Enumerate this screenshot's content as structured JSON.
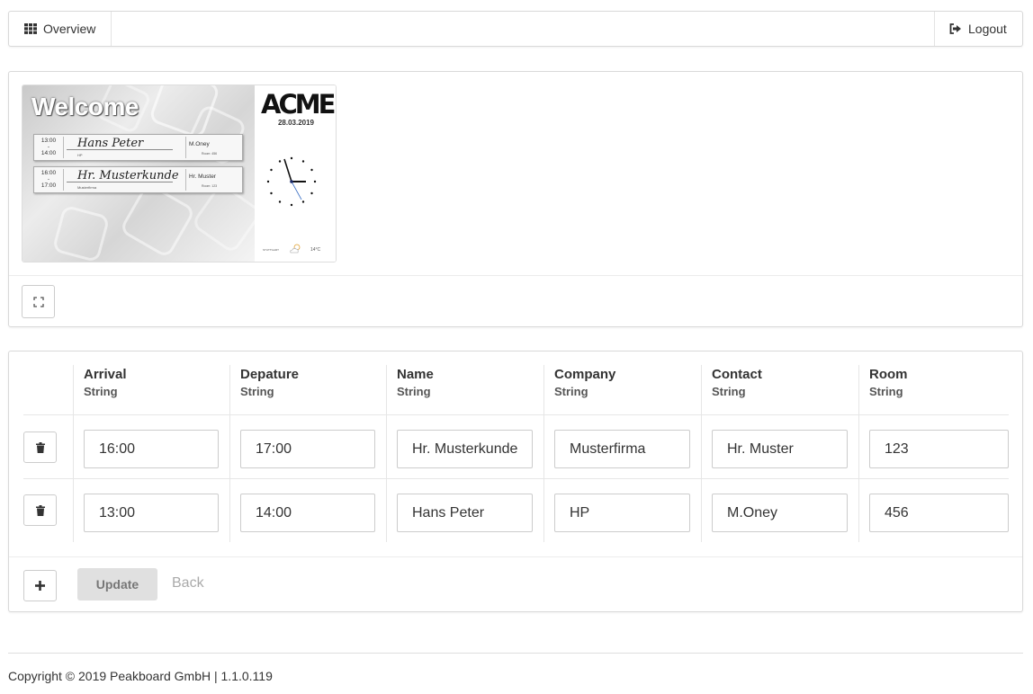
{
  "nav": {
    "overview_label": "Overview",
    "logout_label": "Logout"
  },
  "preview": {
    "welcome_text": "Welcome",
    "logo_text": "ACME",
    "date": "28.03.2019",
    "meetings": [
      {
        "start": "13:00",
        "end": "14:00",
        "name": "Hans Peter",
        "company": "HP",
        "contact": "M.Oney",
        "room": "Room: 456"
      },
      {
        "start": "16:00",
        "end": "17:00",
        "name": "Hr. Musterkunde",
        "company": "Musterfirma",
        "contact": "Hr. Muster",
        "room": "Room: 123"
      }
    ],
    "weather_city": "STUTTGART",
    "temperature": "14°C"
  },
  "table": {
    "columns": [
      {
        "title": "Arrival",
        "type": "String"
      },
      {
        "title": "Depature",
        "type": "String"
      },
      {
        "title": "Name",
        "type": "String"
      },
      {
        "title": "Company",
        "type": "String"
      },
      {
        "title": "Contact",
        "type": "String"
      },
      {
        "title": "Room",
        "type": "String"
      }
    ],
    "rows": [
      {
        "arrival": "16:00",
        "departure": "17:00",
        "name": "Hr. Musterkunde",
        "company": "Musterfirma",
        "contact": "Hr. Muster",
        "room": "123"
      },
      {
        "arrival": "13:00",
        "departure": "14:00",
        "name": "Hans Peter",
        "company": "HP",
        "contact": "M.Oney",
        "room": "456"
      }
    ],
    "update_label": "Update",
    "back_label": "Back"
  },
  "footer": {
    "copyright": "Copyright © 2019 Peakboard GmbH | 1.1.0.119"
  }
}
